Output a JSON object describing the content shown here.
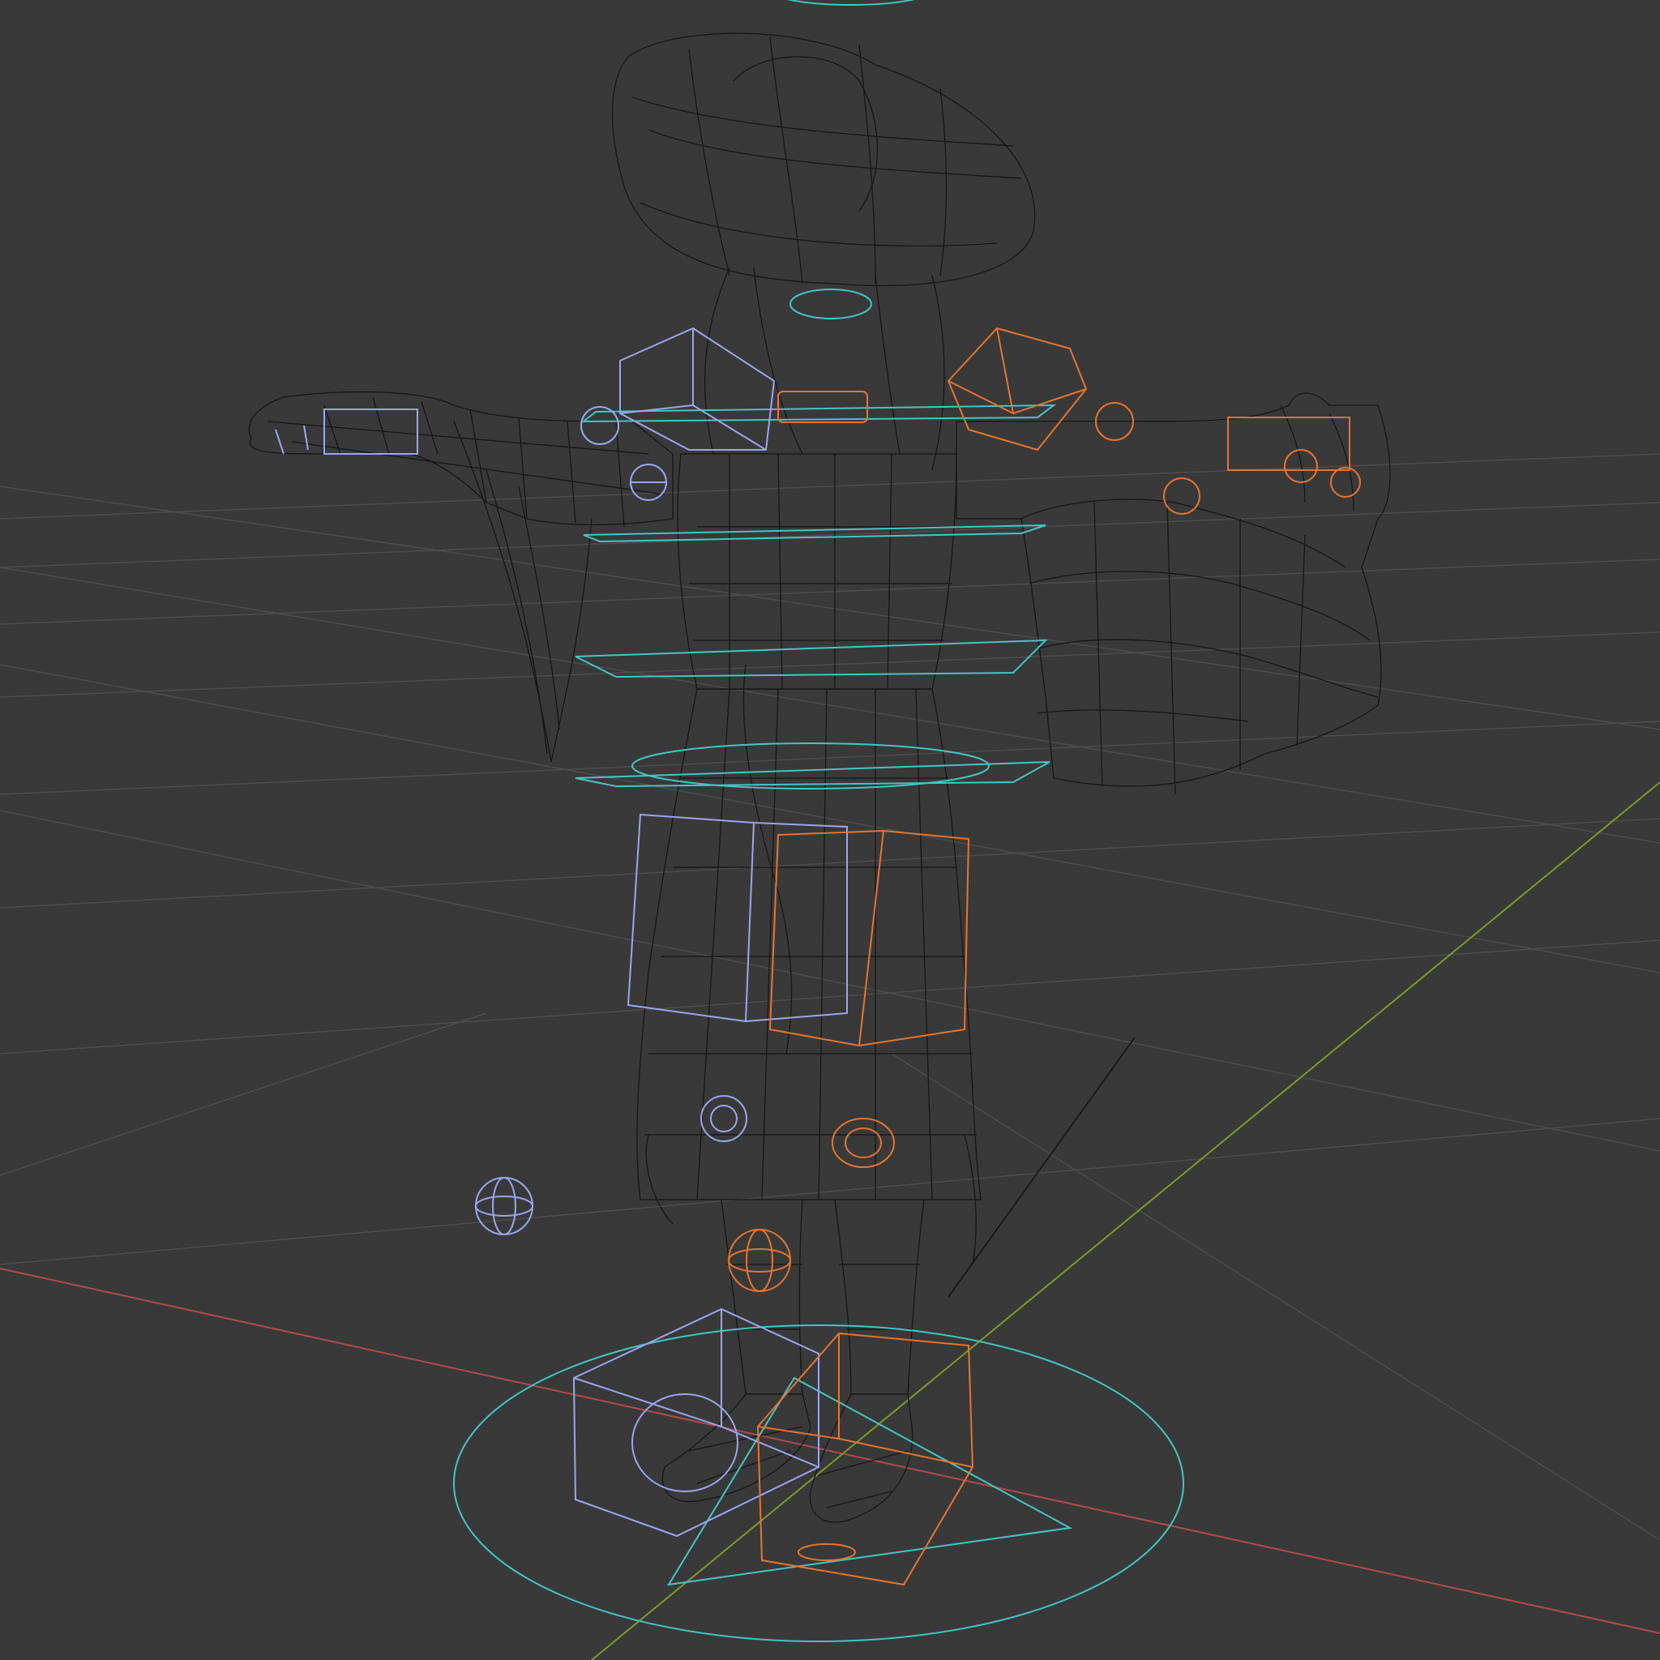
{
  "viewport": {
    "mode": "wireframe",
    "background": "#393939",
    "colors": {
      "grid": "#4d4d4d",
      "x_axis": "#b34a4a",
      "y_axis": "#7d9a2a",
      "mesh": "#161616",
      "control": "#43c6c6",
      "left_controls": "#9aa6f0",
      "right_controls": "#e7742f"
    }
  }
}
